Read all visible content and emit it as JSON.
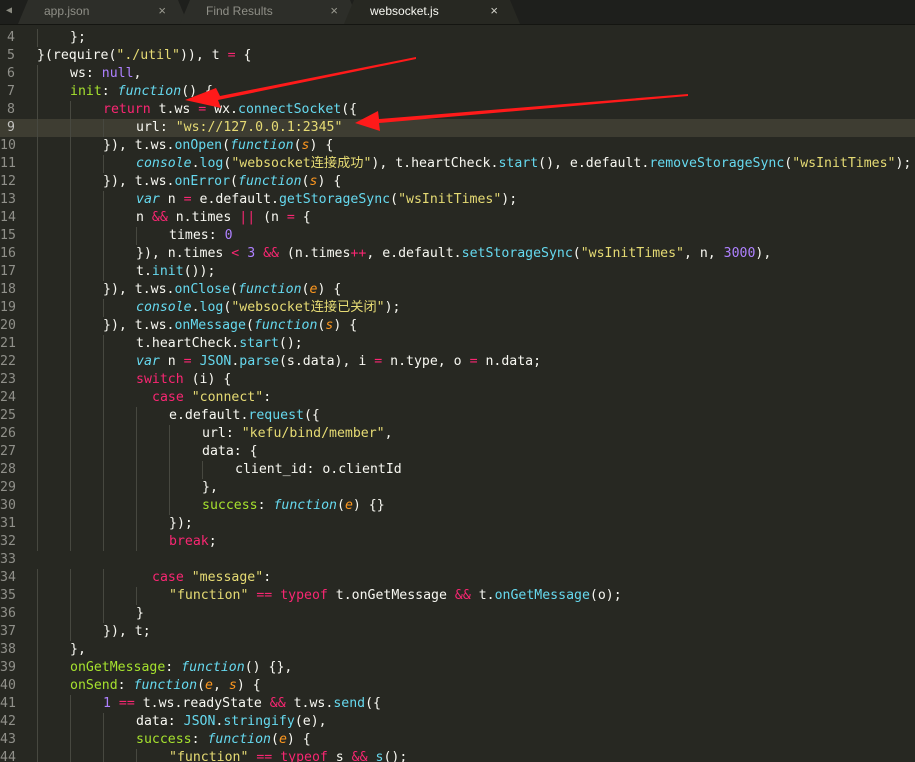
{
  "tabs": [
    {
      "label": "app.json",
      "close": "×"
    },
    {
      "label": "Find Results",
      "close": "×"
    },
    {
      "label": "websocket.js",
      "close": "×",
      "active": true
    }
  ],
  "editor": {
    "current_line": 9,
    "lines": [
      {
        "num": 4,
        "indent": 1,
        "tokens": [
          [
            "t",
            "};"
          ]
        ]
      },
      {
        "num": 5,
        "indent": 0,
        "tokens": [
          [
            "t",
            "}("
          ],
          [
            "t",
            "require("
          ],
          [
            "s",
            "\"./util\""
          ],
          [
            "t",
            ")), t "
          ],
          [
            "k",
            "="
          ],
          [
            "t",
            " {"
          ]
        ]
      },
      {
        "num": 6,
        "indent": 1,
        "tokens": [
          [
            "t",
            "ws: "
          ],
          [
            "n",
            "null"
          ],
          [
            "t",
            ","
          ]
        ]
      },
      {
        "num": 7,
        "indent": 1,
        "tokens": [
          [
            "f",
            "init"
          ],
          [
            "t",
            ": "
          ],
          [
            "ci",
            "function"
          ],
          [
            "t",
            "() {"
          ]
        ]
      },
      {
        "num": 8,
        "indent": 2,
        "tokens": [
          [
            "k",
            "return"
          ],
          [
            "t",
            " t.ws "
          ],
          [
            "k",
            "="
          ],
          [
            "t",
            " wx."
          ],
          [
            "c",
            "connectSocket"
          ],
          [
            "t",
            "({"
          ]
        ]
      },
      {
        "num": 9,
        "indent": 3,
        "tokens": [
          [
            "t",
            "url: "
          ],
          [
            "s",
            "\"ws://127.0.0.1:2345\""
          ]
        ]
      },
      {
        "num": 10,
        "indent": 2,
        "tokens": [
          [
            "t",
            "}), t.ws."
          ],
          [
            "c",
            "onOpen"
          ],
          [
            "t",
            "("
          ],
          [
            "ci",
            "function"
          ],
          [
            "t",
            "("
          ],
          [
            "p",
            "s"
          ],
          [
            "t",
            ") {"
          ]
        ]
      },
      {
        "num": 11,
        "indent": 3,
        "tokens": [
          [
            "ci",
            "console"
          ],
          [
            "t",
            "."
          ],
          [
            "c",
            "log"
          ],
          [
            "t",
            "("
          ],
          [
            "s",
            "\"websocket连接成功\""
          ],
          [
            "t",
            "), t.heartCheck."
          ],
          [
            "c",
            "start"
          ],
          [
            "t",
            "(), e.default."
          ],
          [
            "c",
            "removeStorageSync"
          ],
          [
            "t",
            "("
          ],
          [
            "s",
            "\"wsInitTimes\""
          ],
          [
            "t",
            ");"
          ]
        ]
      },
      {
        "num": 12,
        "indent": 2,
        "tokens": [
          [
            "t",
            "}), t.ws."
          ],
          [
            "c",
            "onError"
          ],
          [
            "t",
            "("
          ],
          [
            "ci",
            "function"
          ],
          [
            "t",
            "("
          ],
          [
            "p",
            "s"
          ],
          [
            "t",
            ") {"
          ]
        ]
      },
      {
        "num": 13,
        "indent": 3,
        "tokens": [
          [
            "ci",
            "var"
          ],
          [
            "t",
            " n "
          ],
          [
            "k",
            "="
          ],
          [
            "t",
            " e.default."
          ],
          [
            "c",
            "getStorageSync"
          ],
          [
            "t",
            "("
          ],
          [
            "s",
            "\"wsInitTimes\""
          ],
          [
            "t",
            ");"
          ]
        ]
      },
      {
        "num": 14,
        "indent": 3,
        "tokens": [
          [
            "t",
            "n "
          ],
          [
            "k",
            "&&"
          ],
          [
            "t",
            " n.times "
          ],
          [
            "k",
            "||"
          ],
          [
            "t",
            " (n "
          ],
          [
            "k",
            "="
          ],
          [
            "t",
            " {"
          ]
        ]
      },
      {
        "num": 15,
        "indent": 4,
        "tokens": [
          [
            "t",
            "times: "
          ],
          [
            "n",
            "0"
          ]
        ]
      },
      {
        "num": 16,
        "indent": 3,
        "tokens": [
          [
            "t",
            "}), n.times "
          ],
          [
            "k",
            "<"
          ],
          [
            "t",
            " "
          ],
          [
            "n",
            "3"
          ],
          [
            "t",
            " "
          ],
          [
            "k",
            "&&"
          ],
          [
            "t",
            " (n.times"
          ],
          [
            "k",
            "++"
          ],
          [
            "t",
            ", e.default."
          ],
          [
            "c",
            "setStorageSync"
          ],
          [
            "t",
            "("
          ],
          [
            "s",
            "\"wsInitTimes\""
          ],
          [
            "t",
            ", n, "
          ],
          [
            "n",
            "3000"
          ],
          [
            "t",
            "),"
          ]
        ]
      },
      {
        "num": 17,
        "indent": 3,
        "tokens": [
          [
            "t",
            "t."
          ],
          [
            "c",
            "init"
          ],
          [
            "t",
            "());"
          ]
        ]
      },
      {
        "num": 18,
        "indent": 2,
        "tokens": [
          [
            "t",
            "}), t.ws."
          ],
          [
            "c",
            "onClose"
          ],
          [
            "t",
            "("
          ],
          [
            "ci",
            "function"
          ],
          [
            "t",
            "("
          ],
          [
            "p",
            "e"
          ],
          [
            "t",
            ") {"
          ]
        ]
      },
      {
        "num": 19,
        "indent": 3,
        "tokens": [
          [
            "ci",
            "console"
          ],
          [
            "t",
            "."
          ],
          [
            "c",
            "log"
          ],
          [
            "t",
            "("
          ],
          [
            "s",
            "\"websocket连接已关闭\""
          ],
          [
            "t",
            ");"
          ]
        ]
      },
      {
        "num": 20,
        "indent": 2,
        "tokens": [
          [
            "t",
            "}), t.ws."
          ],
          [
            "c",
            "onMessage"
          ],
          [
            "t",
            "("
          ],
          [
            "ci",
            "function"
          ],
          [
            "t",
            "("
          ],
          [
            "p",
            "s"
          ],
          [
            "t",
            ") {"
          ]
        ]
      },
      {
        "num": 21,
        "indent": 3,
        "tokens": [
          [
            "t",
            "t.heartCheck."
          ],
          [
            "c",
            "start"
          ],
          [
            "t",
            "();"
          ]
        ]
      },
      {
        "num": 22,
        "indent": 3,
        "tokens": [
          [
            "ci",
            "var"
          ],
          [
            "t",
            " n "
          ],
          [
            "k",
            "="
          ],
          [
            "t",
            " "
          ],
          [
            "c",
            "JSON"
          ],
          [
            "t",
            "."
          ],
          [
            "c",
            "parse"
          ],
          [
            "t",
            "(s.data), i "
          ],
          [
            "k",
            "="
          ],
          [
            "t",
            " n.type, o "
          ],
          [
            "k",
            "="
          ],
          [
            "t",
            " n.data;"
          ]
        ]
      },
      {
        "num": 23,
        "indent": 3,
        "tokens": [
          [
            "k",
            "switch"
          ],
          [
            "t",
            " (i) {"
          ]
        ]
      },
      {
        "num": 24,
        "indent": 3,
        "extra": 2,
        "tokens": [
          [
            "k",
            "case"
          ],
          [
            "t",
            " "
          ],
          [
            "s",
            "\"connect\""
          ],
          [
            "t",
            ":"
          ]
        ]
      },
      {
        "num": 25,
        "indent": 4,
        "tokens": [
          [
            "t",
            "e.default."
          ],
          [
            "c",
            "request"
          ],
          [
            "t",
            "({"
          ]
        ]
      },
      {
        "num": 26,
        "indent": 5,
        "tokens": [
          [
            "t",
            "url: "
          ],
          [
            "s",
            "\"kefu/bind/member\""
          ],
          [
            "t",
            ","
          ]
        ]
      },
      {
        "num": 27,
        "indent": 5,
        "tokens": [
          [
            "t",
            "data: {"
          ]
        ]
      },
      {
        "num": 28,
        "indent": 6,
        "tokens": [
          [
            "t",
            "client_id: o.clientId"
          ]
        ]
      },
      {
        "num": 29,
        "indent": 5,
        "tokens": [
          [
            "t",
            "},"
          ]
        ]
      },
      {
        "num": 30,
        "indent": 5,
        "tokens": [
          [
            "f",
            "success"
          ],
          [
            "t",
            ": "
          ],
          [
            "ci",
            "function"
          ],
          [
            "t",
            "("
          ],
          [
            "p",
            "e"
          ],
          [
            "t",
            ") {}"
          ]
        ]
      },
      {
        "num": 31,
        "indent": 4,
        "tokens": [
          [
            "t",
            "});"
          ]
        ]
      },
      {
        "num": 32,
        "indent": 4,
        "tokens": [
          [
            "k",
            "break"
          ],
          [
            "t",
            ";"
          ]
        ]
      },
      {
        "num": 33,
        "indent": 0,
        "tokens": []
      },
      {
        "num": 34,
        "indent": 3,
        "extra": 2,
        "tokens": [
          [
            "k",
            "case"
          ],
          [
            "t",
            " "
          ],
          [
            "s",
            "\"message\""
          ],
          [
            "t",
            ":"
          ]
        ]
      },
      {
        "num": 35,
        "indent": 4,
        "tokens": [
          [
            "s",
            "\"function\""
          ],
          [
            "t",
            " "
          ],
          [
            "k",
            "=="
          ],
          [
            "t",
            " "
          ],
          [
            "k",
            "typeof"
          ],
          [
            "t",
            " t.onGetMessage "
          ],
          [
            "k",
            "&&"
          ],
          [
            "t",
            " t."
          ],
          [
            "c",
            "onGetMessage"
          ],
          [
            "t",
            "(o);"
          ]
        ]
      },
      {
        "num": 36,
        "indent": 3,
        "tokens": [
          [
            "t",
            "}"
          ]
        ]
      },
      {
        "num": 37,
        "indent": 2,
        "tokens": [
          [
            "t",
            "}), t;"
          ]
        ]
      },
      {
        "num": 38,
        "indent": 1,
        "tokens": [
          [
            "t",
            "},"
          ]
        ]
      },
      {
        "num": 39,
        "indent": 1,
        "tokens": [
          [
            "f",
            "onGetMessage"
          ],
          [
            "t",
            ": "
          ],
          [
            "ci",
            "function"
          ],
          [
            "t",
            "() {},"
          ]
        ]
      },
      {
        "num": 40,
        "indent": 1,
        "tokens": [
          [
            "f",
            "onSend"
          ],
          [
            "t",
            ": "
          ],
          [
            "ci",
            "function"
          ],
          [
            "t",
            "("
          ],
          [
            "p",
            "e"
          ],
          [
            "t",
            ", "
          ],
          [
            "p",
            "s"
          ],
          [
            "t",
            ") {"
          ]
        ]
      },
      {
        "num": 41,
        "indent": 2,
        "tokens": [
          [
            "n",
            "1"
          ],
          [
            "t",
            " "
          ],
          [
            "k",
            "=="
          ],
          [
            "t",
            " t.ws.readyState "
          ],
          [
            "k",
            "&&"
          ],
          [
            "t",
            " t.ws."
          ],
          [
            "c",
            "send"
          ],
          [
            "t",
            "({"
          ]
        ]
      },
      {
        "num": 42,
        "indent": 3,
        "tokens": [
          [
            "t",
            "data: "
          ],
          [
            "c",
            "JSON"
          ],
          [
            "t",
            "."
          ],
          [
            "c",
            "stringify"
          ],
          [
            "t",
            "(e),"
          ]
        ]
      },
      {
        "num": 43,
        "indent": 3,
        "tokens": [
          [
            "f",
            "success"
          ],
          [
            "t",
            ": "
          ],
          [
            "ci",
            "function"
          ],
          [
            "t",
            "("
          ],
          [
            "p",
            "e"
          ],
          [
            "t",
            ") {"
          ]
        ]
      },
      {
        "num": 44,
        "indent": 4,
        "tokens": [
          [
            "s",
            "\"function\""
          ],
          [
            "t",
            " "
          ],
          [
            "k",
            "=="
          ],
          [
            "t",
            " "
          ],
          [
            "k",
            "typeof"
          ],
          [
            "t",
            " s "
          ],
          [
            "k",
            "&&"
          ],
          [
            "t",
            " "
          ],
          [
            "c",
            "s"
          ],
          [
            "t",
            "();"
          ]
        ]
      }
    ]
  },
  "annotation": {
    "color": "#ff1a1a",
    "count": 2
  }
}
